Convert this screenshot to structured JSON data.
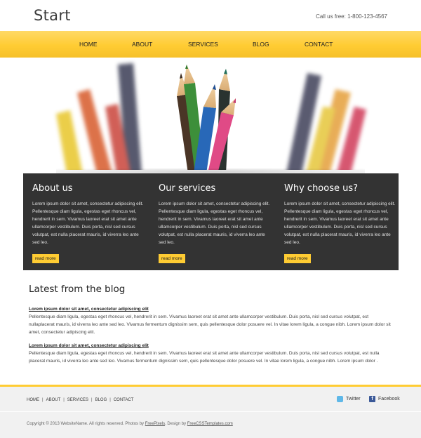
{
  "header": {
    "logo": "Start",
    "phone": "Call us free: 1-800-123-4567"
  },
  "nav": {
    "items": [
      {
        "label": "HOME"
      },
      {
        "label": "ABOUT"
      },
      {
        "label": "SERVICES"
      },
      {
        "label": "BLOG"
      },
      {
        "label": "CONTACT"
      }
    ]
  },
  "features": [
    {
      "title": "About us",
      "text": "Lorem ipsum dolor sit amet, consectetur adipiscing elit. Pellentesque diam ligula, egestas eget rhoncus vel, hendrerit in sem. Vivamus laoreet erat sit amet ante ullamcorper vestibulum. Duis porta, nisl sed cursus volutpat, est nulla placerat mauris, id viverra leo ante sed leo.",
      "button": "read more"
    },
    {
      "title": "Our services",
      "text": "Lorem ipsum dolor sit amet, consectetur adipiscing elit. Pellentesque diam ligula, egestas eget rhoncus vel, hendrerit in sem. Vivamus laoreet erat sit amet ante ullamcorper vestibulum. Duis porta, nisl sed cursus volutpat, est nulla placerat mauris, id viverra leo ante sed leo.",
      "button": "read more"
    },
    {
      "title": "Why choose us?",
      "text": "Lorem ipsum dolor sit amet, consectetur adipiscing elit. Pellentesque diam ligula, egestas eget rhoncus vel, hendrerit in sem. Vivamus laoreet erat sit amet ante ullamcorper vestibulum. Duis porta, nisl sed cursus volutpat, est nulla placerat mauris, id viverra leo ante sed leo.",
      "button": "read more"
    }
  ],
  "blog": {
    "heading": "Latest from the blog",
    "posts": [
      {
        "title": "Lorem ipsum dolor sit amet, consectetur adipiscing elit",
        "body": "Pellentesque diam ligula, egestas eget rhoncus vel, hendrerit in sem. Vivamus laoreet erat sit amet ante ullamcorper vestibulum. Duis porta, nisl sed cursus volutpat, est nullaplacerat mauris, id viverra leo ante sed leo. Vivamus fermentum dignissim sem, quis pellentesque dolor posuere vel. In vitae lorem ligula, a congue nibh. Lorem ipsum dolor sit amet, consectetur adipiscing elit."
      },
      {
        "title": "Lorem ipsum dolor sit amet, consectetur adipiscing elit",
        "body": "Pellentesque diam ligula, egestas eget rhoncus vel, hendrerit in sem. Vivamus laoreet erat sit amet ante ullamcorper vestibulum. Duis porta, nisl sed cursus volutpat, est nulla placerat mauris, id viverra leo ante sed leo. Vivamus fermentum dignissim sem, quis pellentesque dolor posuere vel. In vitae lorem ligula, a congue nibh. Lorem ipsum dolor ."
      }
    ]
  },
  "footer": {
    "nav": [
      "HOME",
      "ABOUT",
      "SERVICES",
      "BLOG",
      "CONTACT"
    ],
    "separator": "|",
    "twitter": "Twitter",
    "facebook": "Facebook",
    "facebook_glyph": "f",
    "copyright_text": "Copyright © 2013 WebsiteName. All rights reserved. Photos by",
    "photos_link": "FreePixels",
    "design_text": ". Design by",
    "design_link": "FreeCSSTemplates.com"
  },
  "colors": {
    "accent": "#ffcc33",
    "dark_panel": "#333333",
    "footer_bg": "#f1f1f1"
  }
}
